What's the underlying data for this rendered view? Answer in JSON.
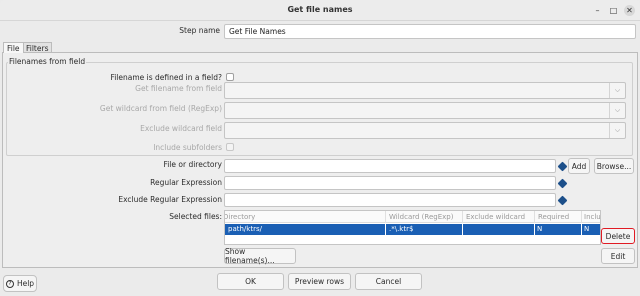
{
  "window": {
    "title": "Get file names"
  },
  "step": {
    "label": "Step name",
    "value": "Get File Names"
  },
  "tabs": [
    {
      "label": "File"
    },
    {
      "label": "Filters"
    }
  ],
  "filenames_from_field": {
    "legend": "Filenames from field",
    "defined_label": "Filename is defined in a field?",
    "get_filename_label": "Get filename from field",
    "get_wildcard_label": "Get wildcard from field (RegExp)",
    "exclude_wildcard_label": "Exclude wildcard field",
    "include_subfolders_label": "Include subfolders"
  },
  "file_or_directory": {
    "label": "File or directory",
    "value": "",
    "add_label": "Add",
    "browse_label": "Browse..."
  },
  "regular_expression": {
    "label": "Regular Expression",
    "value": ""
  },
  "exclude_regular_expression": {
    "label": "Exclude Regular Expression",
    "value": ""
  },
  "selected_files": {
    "label": "Selected files:",
    "columns": [
      "Directory",
      "Wildcard (RegExp)",
      "Exclude wildcard",
      "Required",
      "Inclu"
    ],
    "rows": [
      {
        "directory": "path/ktrs/",
        "wildcard": ".*\\.ktr$",
        "exclude": "",
        "required": "N",
        "include": "N"
      }
    ],
    "delete_label": "Delete",
    "edit_label": "Edit",
    "show_label": "Show filename(s)..."
  },
  "footer": {
    "help_label": "Help",
    "ok_label": "OK",
    "preview_label": "Preview rows",
    "cancel_label": "Cancel"
  },
  "colors": {
    "selection": "#1a5fb4",
    "accent": "#e01b24",
    "var_icon": "#1c4f8a"
  }
}
